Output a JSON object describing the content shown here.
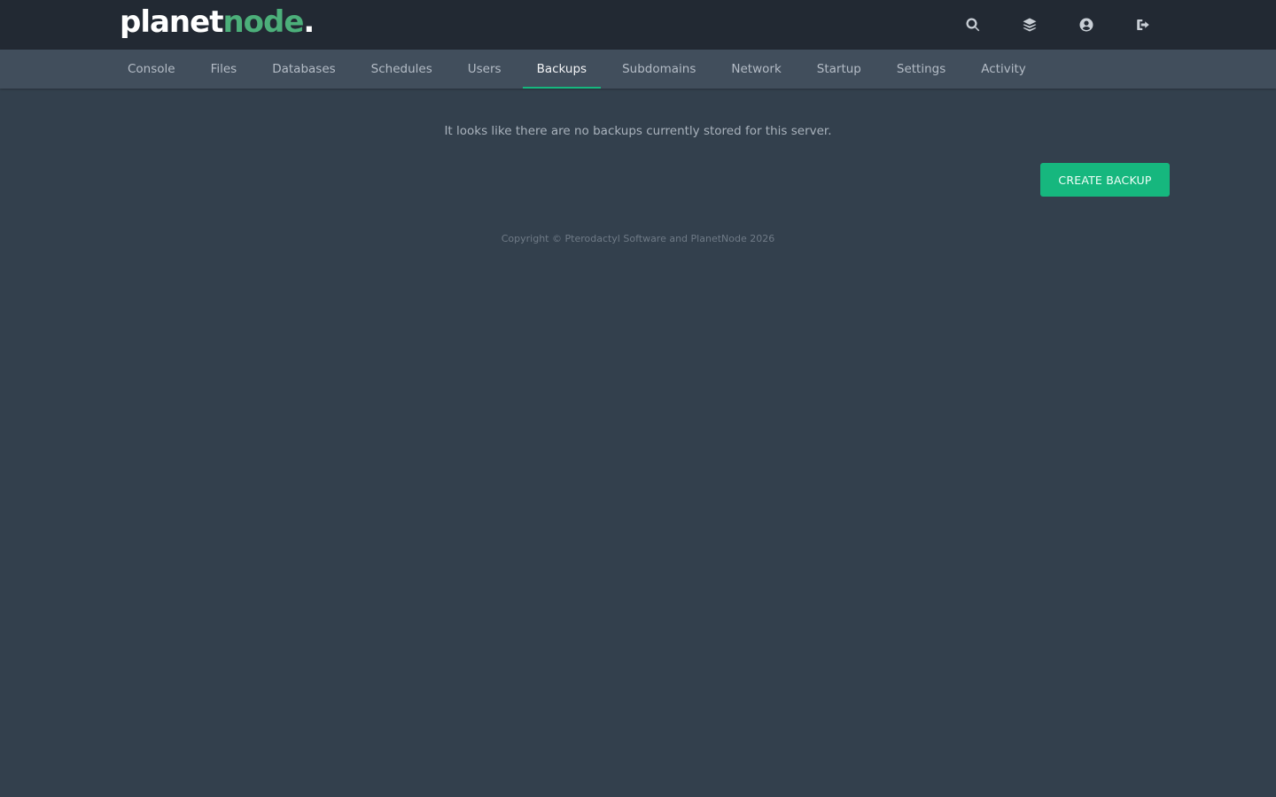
{
  "brand": {
    "logo_main": "planet",
    "logo_accent": "node",
    "logo_dot": ".",
    "accent_color": "#4caf7a"
  },
  "top_icons": [
    {
      "name": "search-icon"
    },
    {
      "name": "layers-icon"
    },
    {
      "name": "user-circle-icon"
    },
    {
      "name": "sign-out-icon"
    }
  ],
  "tabs": [
    {
      "label": "Console",
      "active": false
    },
    {
      "label": "Files",
      "active": false
    },
    {
      "label": "Databases",
      "active": false
    },
    {
      "label": "Schedules",
      "active": false
    },
    {
      "label": "Users",
      "active": false
    },
    {
      "label": "Backups",
      "active": true
    },
    {
      "label": "Subdomains",
      "active": false
    },
    {
      "label": "Network",
      "active": false
    },
    {
      "label": "Startup",
      "active": false
    },
    {
      "label": "Settings",
      "active": false
    },
    {
      "label": "Activity",
      "active": false
    }
  ],
  "backups": {
    "empty_message": "It looks like there are no backups currently stored for this server.",
    "create_button_label": "CREATE BACKUP"
  },
  "footer": {
    "copyright": "Copyright © Pterodactyl Software and PlanetNode 2026"
  },
  "colors": {
    "topbar": "#222933",
    "subnav": "#414e5c",
    "page_background": "#33404d",
    "primary_button": "#16b77e"
  }
}
